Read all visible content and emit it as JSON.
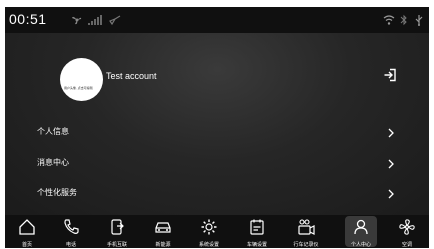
{
  "status_bar": {
    "time": "00:51",
    "icons": [
      "fan-icon",
      "signal-icon",
      "nav-icon",
      "wifi-icon",
      "bluetooth-icon",
      "usb-icon"
    ]
  },
  "account": {
    "name": "Test account",
    "avatar_icon": "avatar",
    "logout_icon": "logout-icon"
  },
  "menu": [
    {
      "label": "个人信息"
    },
    {
      "label": "消息中心"
    },
    {
      "label": "个性化服务"
    }
  ],
  "bottom_nav": [
    {
      "label": "首页",
      "icon": "home-icon"
    },
    {
      "label": "电话",
      "icon": "phone-icon"
    },
    {
      "label": "手机互联",
      "icon": "phone-link-icon"
    },
    {
      "label": "新能源",
      "icon": "car-icon"
    },
    {
      "label": "系统设置",
      "icon": "gear-icon"
    },
    {
      "label": "车辆设置",
      "icon": "vehicle-settings-icon"
    },
    {
      "label": "行车记录仪",
      "icon": "dashcam-icon"
    },
    {
      "label": "个人中心",
      "icon": "person-icon",
      "active": true
    },
    {
      "label": "空调",
      "icon": "fan-icon"
    }
  ],
  "colors": {
    "background": "#1b1b1b",
    "bar": "#101010",
    "text": "#ffffff",
    "active": "#3a3a3a"
  }
}
